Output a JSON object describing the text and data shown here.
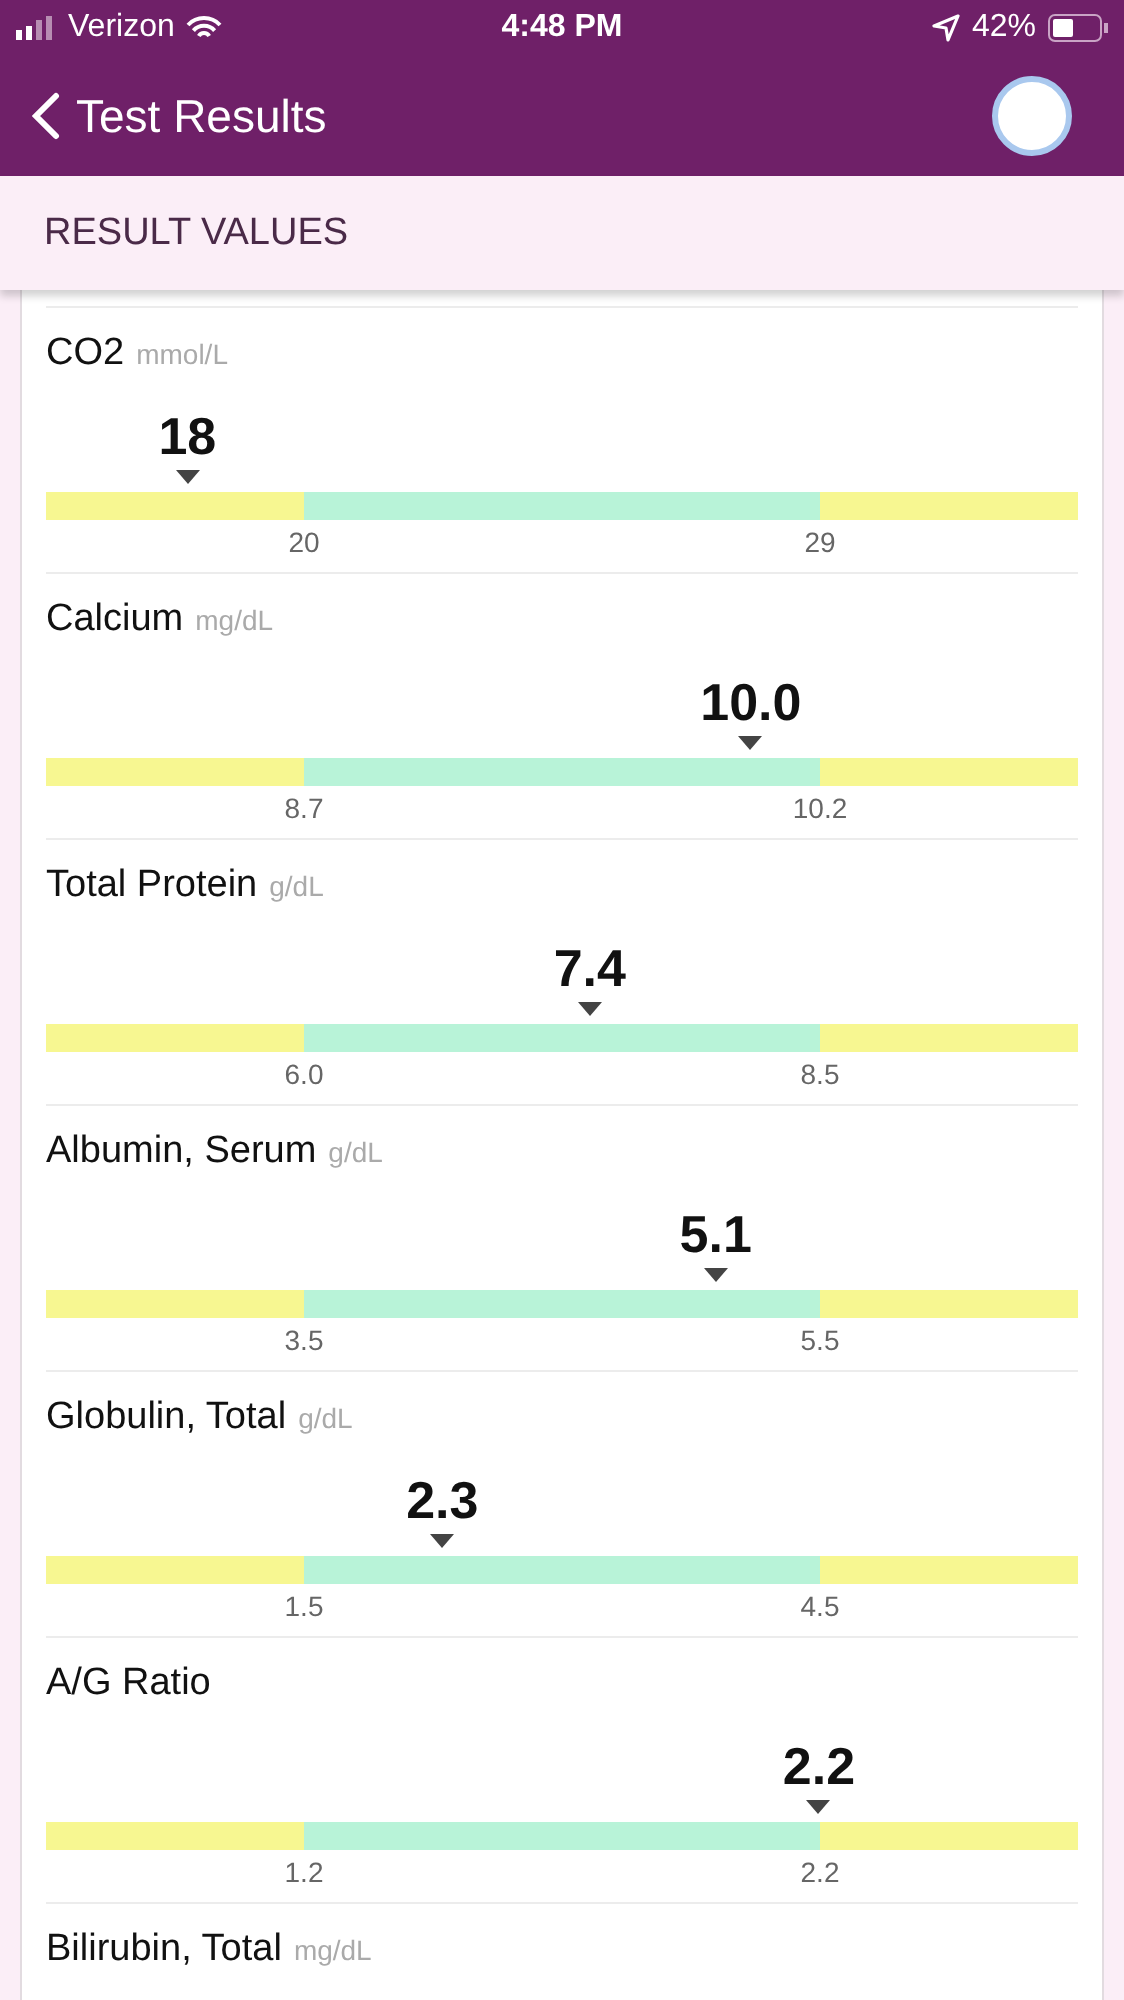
{
  "status_bar": {
    "carrier": "Verizon",
    "time": "4:48 PM",
    "battery": "42%"
  },
  "nav": {
    "title": "Test Results"
  },
  "section": {
    "title": "RESULT VALUES"
  },
  "results": [
    {
      "name": "CO2",
      "unit": "mmol/L",
      "value": "18",
      "level": 0.137,
      "low": "20",
      "high": "29"
    },
    {
      "name": "Calcium",
      "unit": "mg/dL",
      "value": "10.0",
      "level": 0.683,
      "low": "8.7",
      "high": "10.2"
    },
    {
      "name": "Total Protein",
      "unit": "g/dL",
      "value": "7.4",
      "level": 0.527,
      "low": "6.0",
      "high": "8.5"
    },
    {
      "name": "Albumin, Serum",
      "unit": "g/dL",
      "value": "5.1",
      "level": 0.649,
      "low": "3.5",
      "high": "5.5"
    },
    {
      "name": "Globulin, Total",
      "unit": "g/dL",
      "value": "2.3",
      "level": 0.384,
      "low": "1.5",
      "high": "4.5"
    },
    {
      "name": "A/G Ratio",
      "value": "2.2",
      "level": 0.749,
      "low": "1.2",
      "high": "2.2"
    },
    {
      "name": "Bilirubin, Total",
      "unit": "mg/dL"
    }
  ]
}
